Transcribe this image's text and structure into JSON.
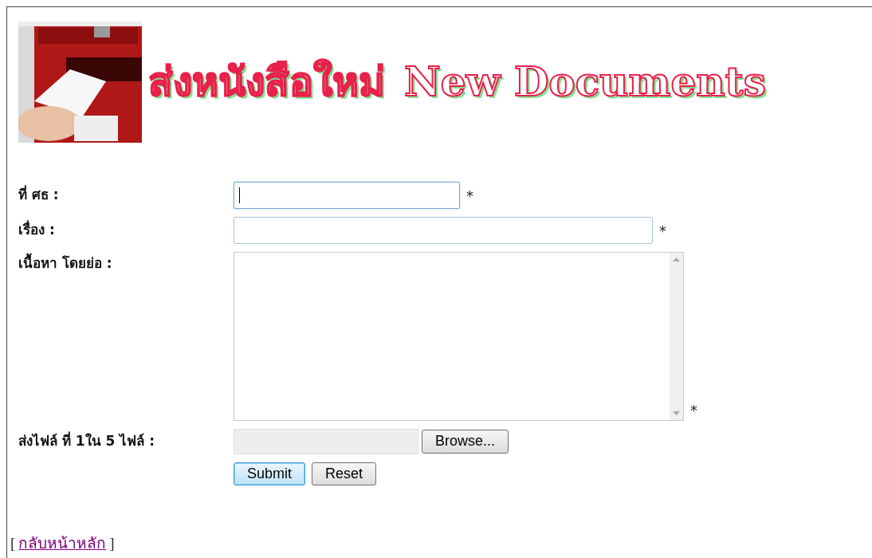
{
  "header": {
    "title_thai": "ส่งหนังสือใหม่",
    "title_english": "New Documents"
  },
  "fields": [
    {
      "kind": "short-text",
      "label": "ที่ ศธ :",
      "focused": true,
      "required_mark": "*"
    },
    {
      "kind": "long-text",
      "label": "เรื่อง :",
      "focused": false,
      "required_mark": "*"
    },
    {
      "kind": "textarea",
      "label": "เนื้อหา โดยย่อ :",
      "focused": false,
      "required_mark": "*"
    },
    {
      "kind": "file",
      "label": "ส่งไฟล์ ที่ 1ใน 5 ไฟล์ :",
      "focused": false,
      "button": "Browse..."
    }
  ],
  "buttons": [
    {
      "label": "Submit",
      "focused": true
    },
    {
      "label": "Reset",
      "focused": false
    }
  ],
  "footer": {
    "open_bracket": "[",
    "link": "กลับหน้าหลัก",
    "close_bracket": "]"
  }
}
